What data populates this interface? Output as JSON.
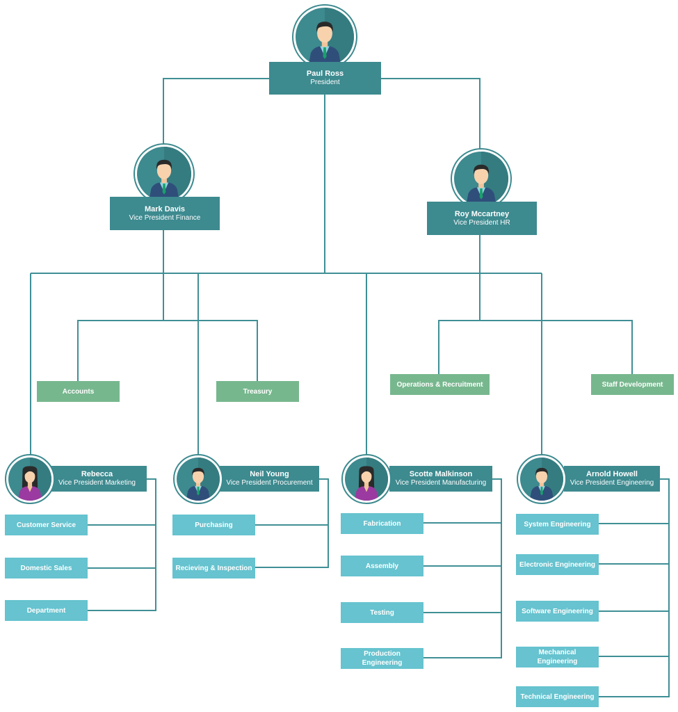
{
  "colors": {
    "connector": "#3f8f95",
    "executive_box": "#3d8a8f",
    "department_green": "#77b78e",
    "department_teal": "#66c3cf",
    "text": "#ffffff"
  },
  "president": {
    "name": "Paul Ross",
    "title": "President",
    "avatar": "male-avatar-icon"
  },
  "vp_finance": {
    "name": "Mark Davis",
    "title": "Vice President Finance",
    "avatar": "male-avatar-icon",
    "departments": [
      "Accounts",
      "Treasury"
    ]
  },
  "vp_hr": {
    "name": "Roy Mccartney",
    "title": "Vice President HR",
    "avatar": "male-avatar-icon",
    "departments": [
      "Operations & Recruitment",
      "Staff Development"
    ]
  },
  "vp_marketing": {
    "name": "Rebecca",
    "title": "Vice President Marketing",
    "avatar": "female-avatar-icon",
    "departments": [
      "Customer Service",
      "Domestic Sales",
      "Department"
    ]
  },
  "vp_procurement": {
    "name": "Neil Young",
    "title": "Vice President Procurement",
    "avatar": "male-avatar-icon",
    "departments": [
      "Purchasing",
      "Recieving & Inspection"
    ]
  },
  "vp_manufacturing": {
    "name": "Scotte Malkinson",
    "title": "Vice President Manufacturing",
    "avatar": "female-avatar-icon",
    "departments": [
      "Fabrication",
      "Assembly",
      "Testing",
      "Production Engineering"
    ]
  },
  "vp_engineering": {
    "name": "Arnold Howell",
    "title": "Vice President Engineering",
    "avatar": "male-avatar-icon",
    "departments": [
      "System Engineering",
      "Electronic Engineering",
      "Software Engineering",
      "Mechanical Engineering",
      "Technical Engineering"
    ]
  }
}
